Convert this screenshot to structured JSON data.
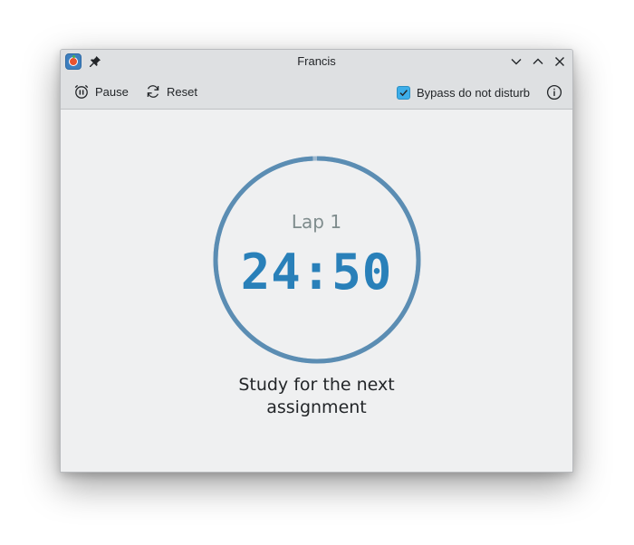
{
  "window": {
    "title": "Francis"
  },
  "icons": {
    "app": "francis-app-icon",
    "pin": "pin-icon",
    "minimize": "chevron-down-icon",
    "maximize": "chevron-up-icon",
    "close": "close-icon",
    "pause": "alarm-clock-pause-icon",
    "reset": "refresh-icon",
    "info": "info-icon"
  },
  "toolbar": {
    "pause_label": "Pause",
    "reset_label": "Reset",
    "bypass_label": "Bypass do not disturb",
    "bypass_checked": true
  },
  "timer": {
    "lap_label": "Lap 1",
    "time": "24:50",
    "progress": 0.993,
    "task_line1": "Study for the next",
    "task_line2": "assignment"
  },
  "colors": {
    "accent": "#3daee9",
    "time_text": "#2980b9",
    "ring": "#5b8db3",
    "background": "#eff0f1"
  }
}
